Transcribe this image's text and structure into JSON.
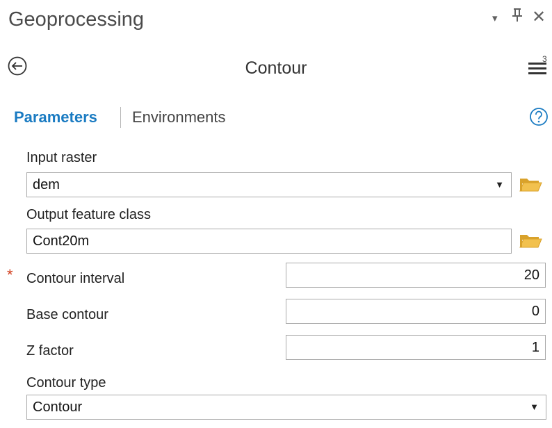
{
  "window": {
    "title": "Geoprocessing",
    "menu_glyph": "▾",
    "pin_glyph": "⊥",
    "close_glyph": "✕"
  },
  "tool": {
    "title": "Contour",
    "back_icon": "back-arrow-icon",
    "menu_icon": "hamburger-menu-icon",
    "menu_badge": "3"
  },
  "tabs": {
    "parameters": "Parameters",
    "environments": "Environments",
    "help_icon": "question-mark-icon",
    "active": "parameters"
  },
  "params": {
    "input_raster": {
      "label": "Input raster",
      "value": "dem",
      "icon": "folder-open-icon"
    },
    "output_feature_class": {
      "label": "Output feature class",
      "value": "Cont20m",
      "icon": "folder-open-icon"
    },
    "contour_interval": {
      "label": "Contour interval",
      "value": "20",
      "required_marker": "*"
    },
    "base_contour": {
      "label": "Base contour",
      "value": "0"
    },
    "z_factor": {
      "label": "Z factor",
      "value": "1"
    },
    "contour_type": {
      "label": "Contour type",
      "value": "Contour"
    }
  },
  "colors": {
    "accent": "#1a7bc2",
    "required": "#d13d1c",
    "folder": "#e8b33a"
  }
}
